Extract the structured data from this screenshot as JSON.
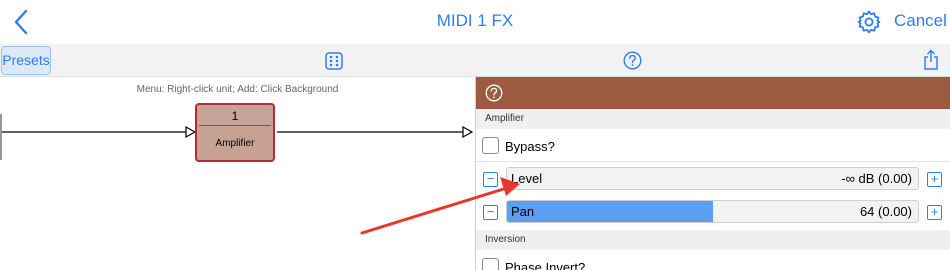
{
  "navbar": {
    "title": "MIDI 1 FX",
    "cancel_label": "Cancel",
    "accent_color": "#2e7cf6"
  },
  "toolbar": {
    "presets_label": "Presets",
    "icons": [
      "grid-dots-icon",
      "help-circle-icon",
      "share-icon"
    ]
  },
  "canvas": {
    "hint": "Menu: Right-click unit; Add: Click Background",
    "unit": {
      "number": "1",
      "name": "Amplifier",
      "color": "#c7a191",
      "border_color": "#b22a3c"
    }
  },
  "panel": {
    "header_color": "#9b5b41",
    "sections": {
      "amplifier": "Amplifier",
      "inversion": "Inversion"
    },
    "bypass": {
      "label": "Bypass?",
      "checked": false
    },
    "level": {
      "label": "Level",
      "value": "-∞ dB (0.00)",
      "fill": 0.0
    },
    "pan": {
      "label": "Pan",
      "value": "64 (0.00)",
      "fill": 0.5
    },
    "phase_invert": {
      "label": "Phase Invert?",
      "checked": false
    },
    "minus": "−",
    "plus": "+"
  },
  "annotation": {
    "arrow_color": "#e8372b"
  }
}
